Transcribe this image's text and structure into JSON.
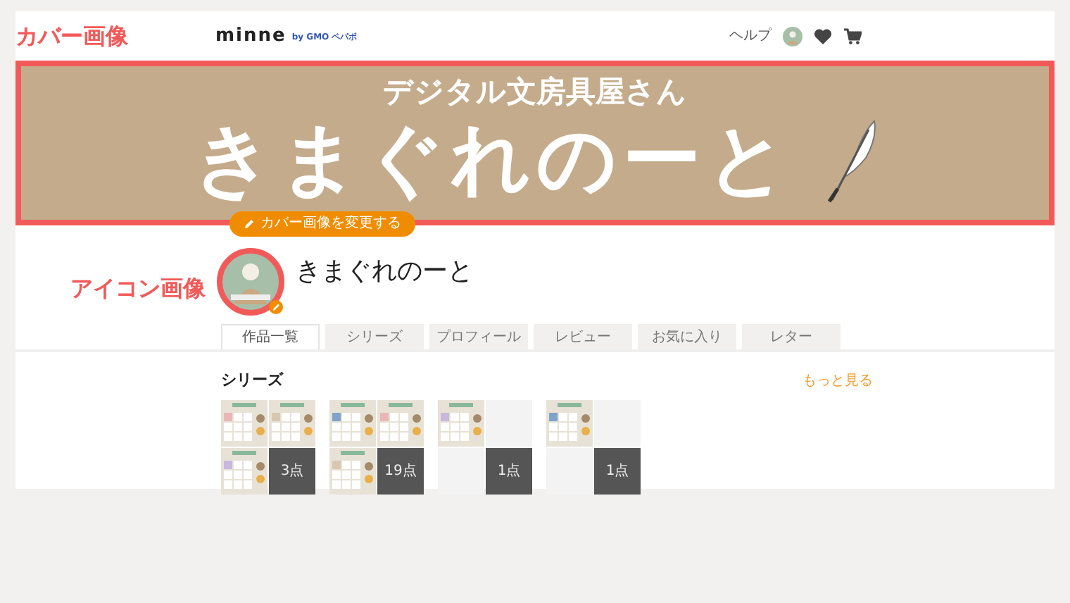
{
  "header": {
    "annotation": "カバー画像",
    "logo": "minne",
    "logo_sub": "by GMO ペパボ",
    "help": "ヘルプ"
  },
  "cover": {
    "subtitle": "デジタル文房具屋さん",
    "title": "きまぐれのーと",
    "change_button": "カバー画像を変更する"
  },
  "profile": {
    "annotation": "アイコン画像",
    "name": "きまぐれのーと"
  },
  "tabs": [
    {
      "label": "作品一覧",
      "selected": true
    },
    {
      "label": "シリーズ",
      "selected": false
    },
    {
      "label": "プロフィール",
      "selected": false
    },
    {
      "label": "レビュー",
      "selected": false
    },
    {
      "label": "お気に入り",
      "selected": false
    },
    {
      "label": "レター",
      "selected": false
    }
  ],
  "series": {
    "title": "シリーズ",
    "more_link": "もっと見る",
    "groups": [
      {
        "tiles": [
          {
            "kind": "picture"
          },
          {
            "kind": "picture"
          },
          {
            "kind": "picture"
          },
          {
            "kind": "count",
            "text": "3点"
          }
        ]
      },
      {
        "tiles": [
          {
            "kind": "picture"
          },
          {
            "kind": "picture"
          },
          {
            "kind": "picture"
          },
          {
            "kind": "count",
            "text": "19点"
          }
        ]
      },
      {
        "tiles": [
          {
            "kind": "picture"
          },
          {
            "kind": "empty"
          },
          {
            "kind": "empty"
          },
          {
            "kind": "count",
            "text": "1点"
          }
        ]
      },
      {
        "tiles": [
          {
            "kind": "picture"
          },
          {
            "kind": "empty"
          },
          {
            "kind": "empty"
          },
          {
            "kind": "count",
            "text": "1点"
          }
        ]
      }
    ]
  }
}
